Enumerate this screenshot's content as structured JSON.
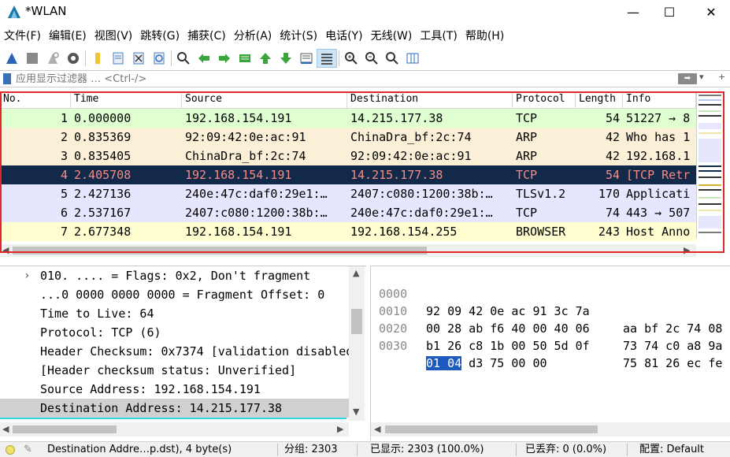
{
  "window": {
    "title": "*WLAN",
    "minimize": "—",
    "maximize": "☐",
    "close": "✕"
  },
  "menu": [
    "文件(F)",
    "编辑(E)",
    "视图(V)",
    "跳转(G)",
    "捕获(C)",
    "分析(A)",
    "统计(S)",
    "电话(Y)",
    "无线(W)",
    "工具(T)",
    "帮助(H)"
  ],
  "toolbar": {
    "icons": [
      "shark-fin-start-icon",
      "stop-square-icon",
      "restart-fin-icon",
      "capture-options-gear-icon",
      "open-folder-icon",
      "save-file-icon",
      "close-file-icon",
      "reload-icon",
      "find-magnifier-icon",
      "go-back-arrow-icon",
      "go-forward-arrow-icon",
      "go-to-packet-icon",
      "go-first-icon",
      "go-last-icon",
      "autoscroll-icon",
      "colorize-icon",
      "zoom-in-icon",
      "zoom-out-icon",
      "normal-size-icon",
      "resize-columns-icon"
    ]
  },
  "filter": {
    "placeholder": "应用显示过滤器 … <Ctrl-/>",
    "apply_arrow": "➡",
    "dropdown": "▾",
    "add": "+"
  },
  "colors": {
    "tcp_row": "#e7e6ff",
    "tcp_syn_row": "#e0ffd0",
    "arp_row": "#faf0d7",
    "browser_row": "#fefed0",
    "selected_row_bg": "#12294a",
    "selected_row_fg": "#f78c86",
    "frame_red": "#e0272b"
  },
  "packet_list": {
    "columns": [
      "No.",
      "Time",
      "Source",
      "Destination",
      "Protocol",
      "Length",
      "Info"
    ],
    "rows": [
      {
        "no": "1",
        "time": "0.000000",
        "src": "192.168.154.191",
        "dst": "14.215.177.38",
        "proto": "TCP",
        "len": "54",
        "info": "51227 → 8"
      },
      {
        "no": "2",
        "time": "0.835369",
        "src": "92:09:42:0e:ac:91",
        "dst": "ChinaDra_bf:2c:74",
        "proto": "ARP",
        "len": "42",
        "info": "Who has 1"
      },
      {
        "no": "3",
        "time": "0.835405",
        "src": "ChinaDra_bf:2c:74",
        "dst": "92:09:42:0e:ac:91",
        "proto": "ARP",
        "len": "42",
        "info": "192.168.1"
      },
      {
        "no": "4",
        "time": "2.405708",
        "src": "192.168.154.191",
        "dst": "14.215.177.38",
        "proto": "TCP",
        "len": "54",
        "info": "[TCP Retr"
      },
      {
        "no": "5",
        "time": "2.427136",
        "src": "240e:47c:daf0:29e1:…",
        "dst": "2407:c080:1200:38b:…",
        "proto": "TLSv1.2",
        "len": "170",
        "info": "Applicati"
      },
      {
        "no": "6",
        "time": "2.537167",
        "src": "2407:c080:1200:38b:…",
        "dst": "240e:47c:daf0:29e1:…",
        "proto": "TCP",
        "len": "74",
        "info": "443 → 507"
      },
      {
        "no": "7",
        "time": "2.677348",
        "src": "192.168.154.191",
        "dst": "192.168.154.255",
        "proto": "BROWSER",
        "len": "243",
        "info": "Host Anno"
      }
    ]
  },
  "details": {
    "lines": [
      "010. .... = Flags: 0x2, Don't fragment",
      "...0 0000 0000 0000 = Fragment Offset: 0",
      "Time to Live: 64",
      "Protocol: TCP (6)",
      "Header Checksum: 0x7374 [validation disabled]",
      "[Header checksum status: Unverified]",
      "Source Address: 192.168.154.191",
      "Destination Address: 14.215.177.38"
    ],
    "expander": "›"
  },
  "bytes": {
    "rows": [
      {
        "offset": "0000",
        "hex1": "92 09 42 0e ac 91 3c 7a",
        "hex2": "aa bf 2c 74 08"
      },
      {
        "offset": "0010",
        "hex1": "00 28 ab f6 40 00 40 06",
        "hex2": "73 74 c0 a8 9a"
      },
      {
        "offset": "0020",
        "hex1": "b1 26 c8 1b 00 50 5d 0f",
        "hex2": "75 81 26 ec fe"
      },
      {
        "offset": "0030",
        "hex1_hl": "01 04",
        "hex1_rest": " d3 75 00 00",
        "hex2": ""
      }
    ]
  },
  "status": {
    "field": "Destination Addre…p.dst), 4 byte(s)",
    "packets": "分组: 2303",
    "displayed": "已显示: 2303 (100.0%)",
    "dropped": "已丢弃: 0 (0.0%)",
    "profile": "配置: Default"
  }
}
